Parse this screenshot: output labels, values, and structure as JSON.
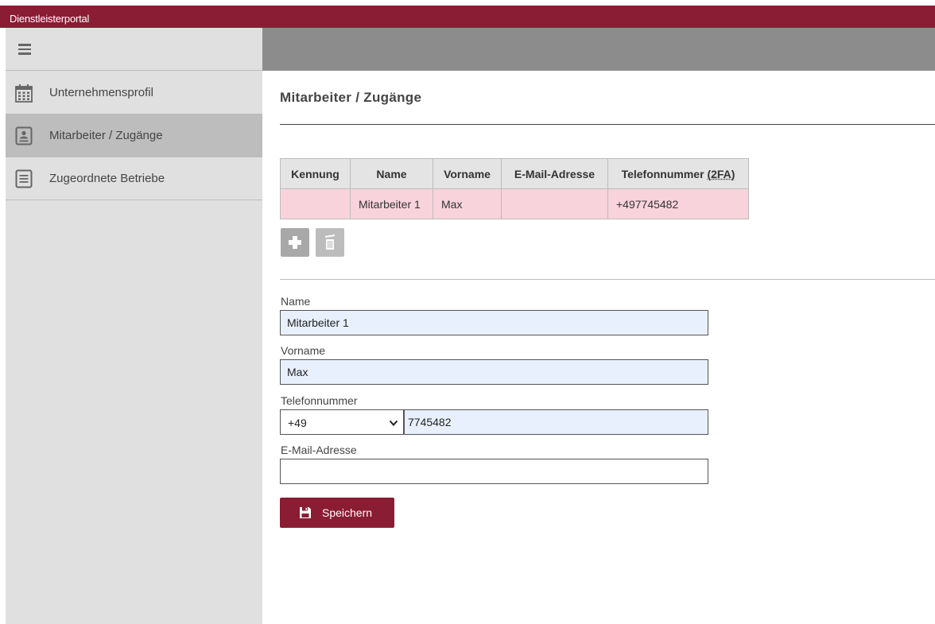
{
  "app": {
    "title": "Dienstleisterportal"
  },
  "sidebar": {
    "items": [
      {
        "label": "Unternehmensprofil",
        "icon": "calendar-icon",
        "active": false
      },
      {
        "label": "Mitarbeiter / Zugänge",
        "icon": "contact-card-icon",
        "active": true
      },
      {
        "label": "Zugeordnete Betriebe",
        "icon": "document-list-icon",
        "active": false
      }
    ]
  },
  "page": {
    "title": "Mitarbeiter / Zugänge"
  },
  "table": {
    "headers": {
      "kennung": "Kennung",
      "name": "Name",
      "vorname": "Vorname",
      "email": "E-Mail-Adresse",
      "phone": "Telefonnummer ",
      "phone_abbr": "(2FA)"
    },
    "rows": [
      {
        "kennung": "",
        "name": "Mitarbeiter 1",
        "vorname": "Max",
        "email": "",
        "phone": "+497745482"
      }
    ]
  },
  "form": {
    "name_label": "Name",
    "name_value": "Mitarbeiter 1",
    "vorname_label": "Vorname",
    "vorname_value": "Max",
    "phone_label": "Telefonnummer",
    "phone_country": "+49",
    "phone_value": "7745482",
    "email_label": "E-Mail-Adresse",
    "email_value": "",
    "save_label": "Speichern"
  },
  "colors": {
    "brand": "#8a1c33",
    "header_gray": "#8c8c8c",
    "sidebar_bg": "#e0e0e0",
    "row_highlight": "#f9d3dc",
    "input_autofill": "#e8f0fe"
  }
}
